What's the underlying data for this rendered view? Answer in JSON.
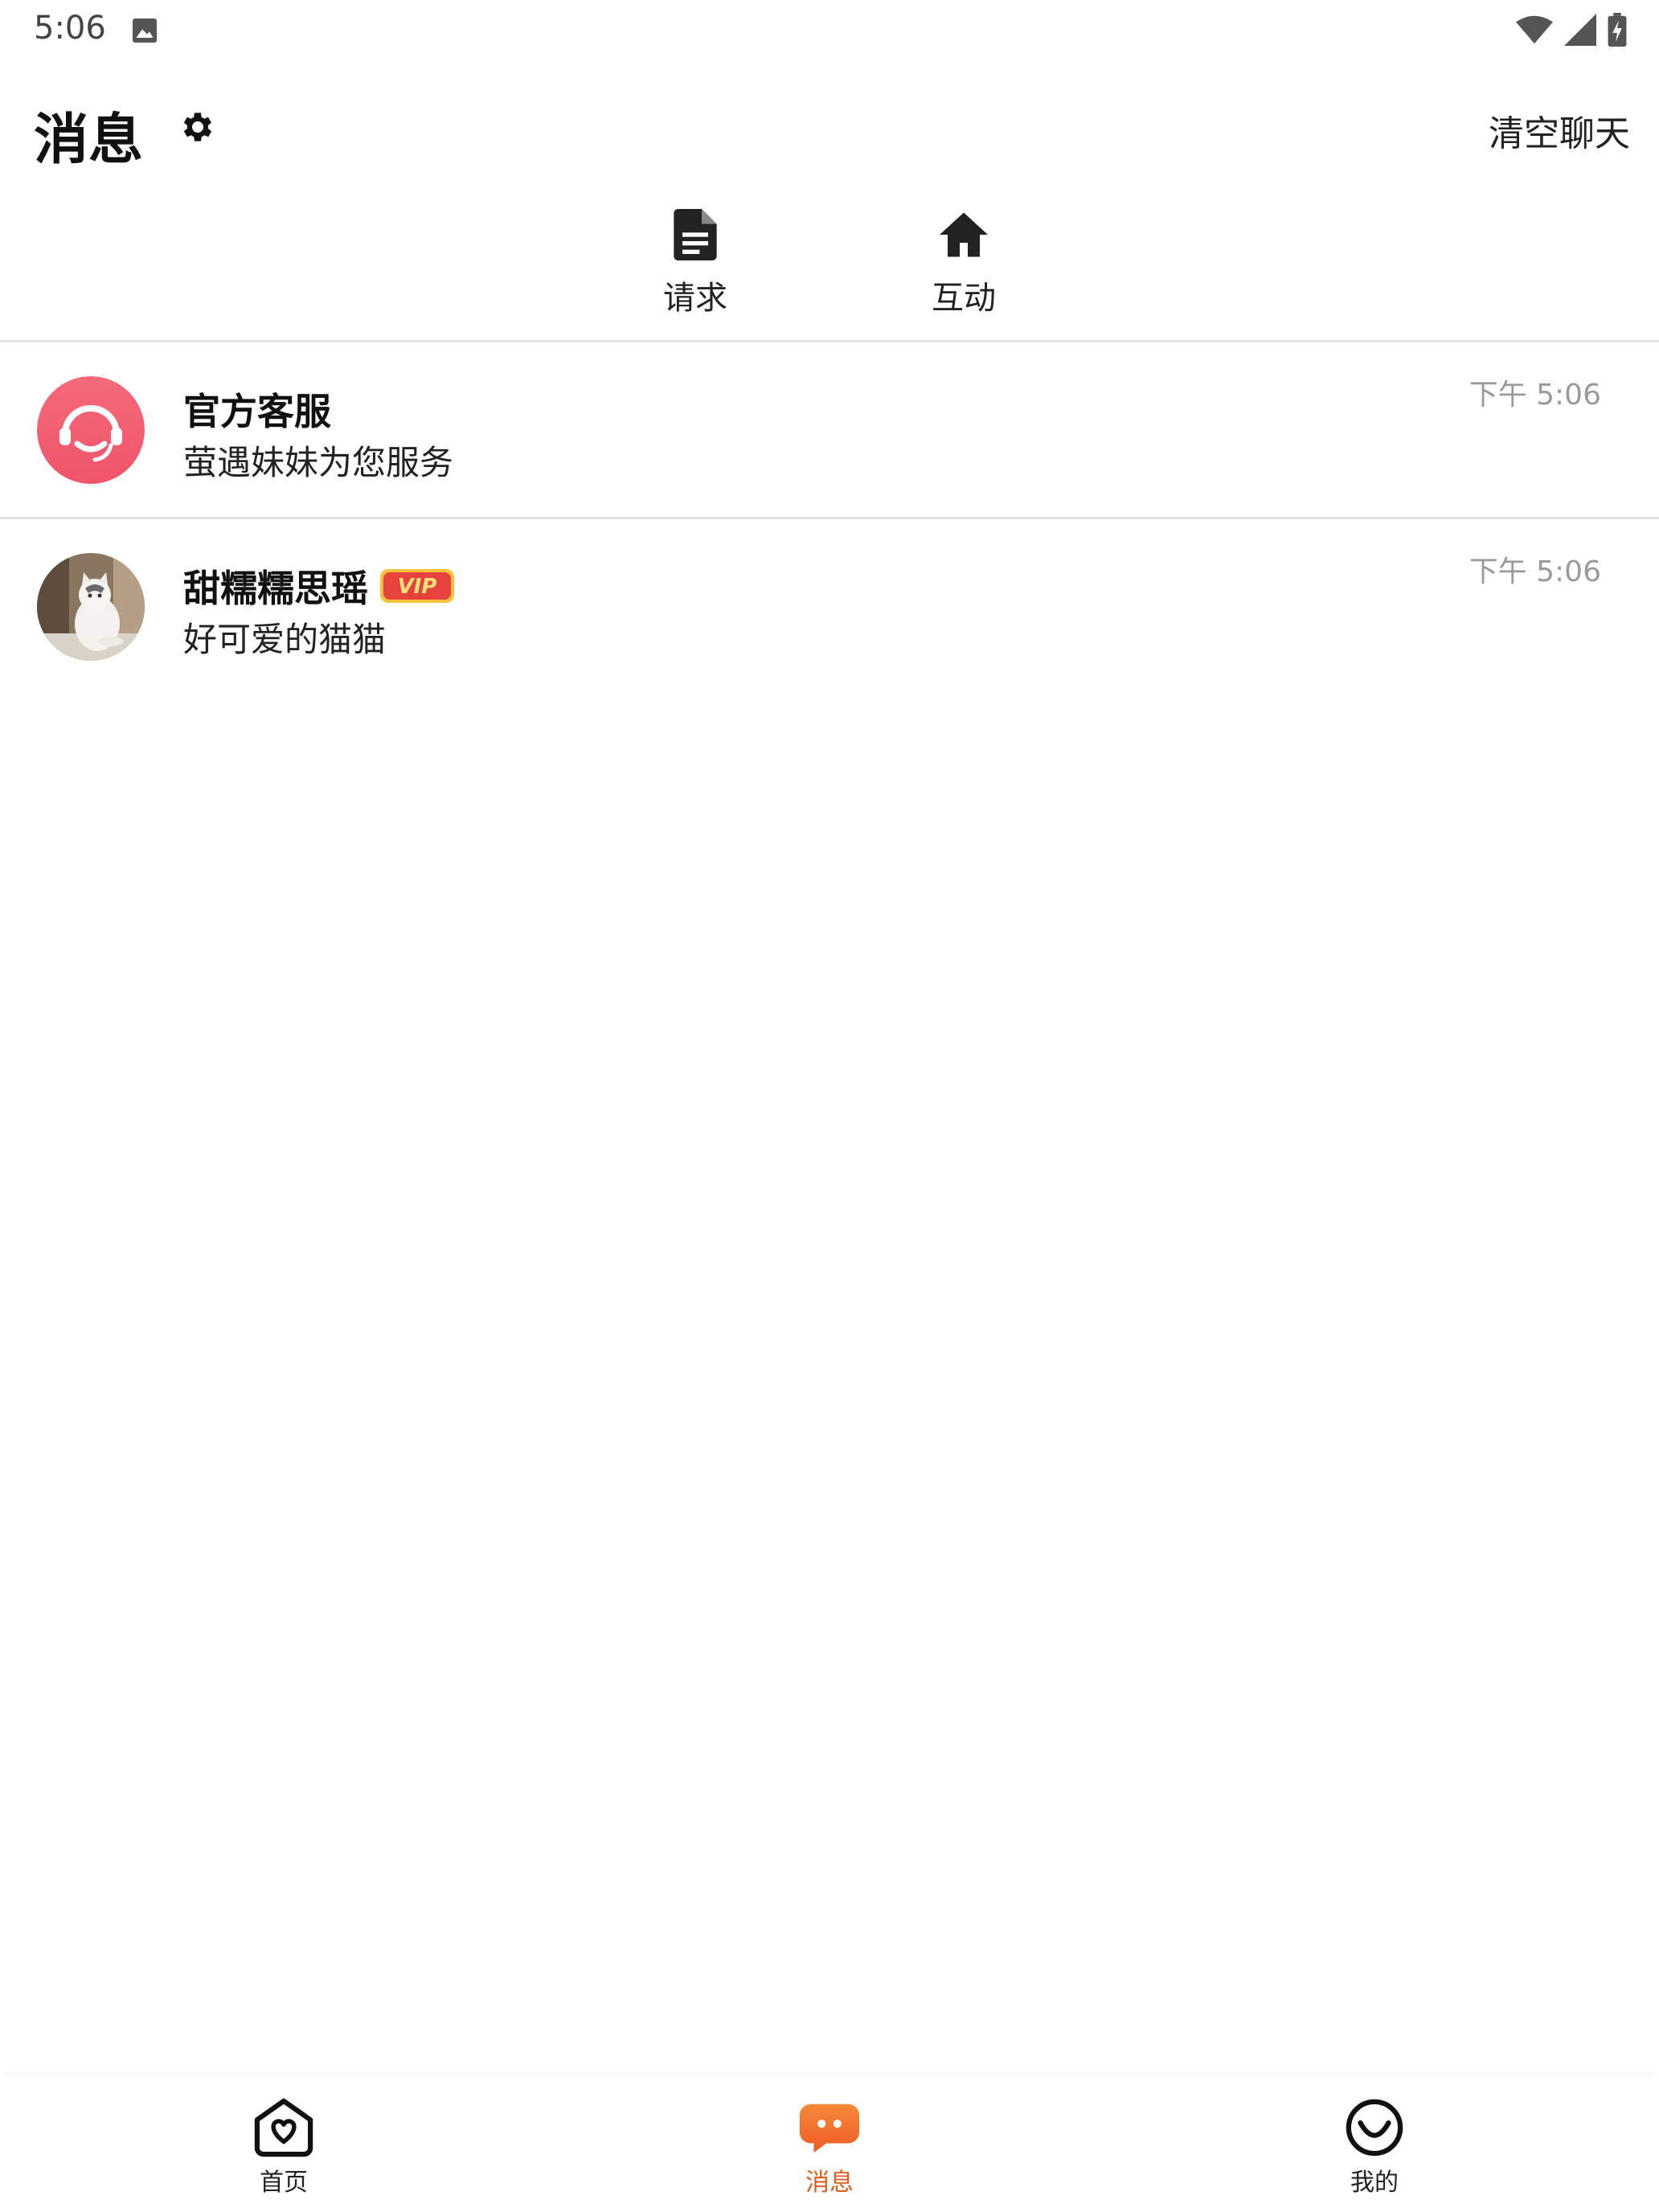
{
  "status_bar": {
    "time": "5:06",
    "icons": [
      "image-icon",
      "wifi-icon",
      "signal-icon",
      "battery-charging-icon"
    ]
  },
  "header": {
    "title": "消息",
    "settings_icon": "gear-icon",
    "clear_label": "清空聊天"
  },
  "tabs": [
    {
      "label": "请求",
      "icon": "document-icon"
    },
    {
      "label": "互动",
      "icon": "home-icon"
    }
  ],
  "conversations": [
    {
      "name": "官方客服",
      "preview": "萤遇妹妹为您服务",
      "time": "下午 5:06",
      "avatar": "customer-service-avatar",
      "vip": false
    },
    {
      "name": "甜糯糯思瑶",
      "preview": "好可爱的猫猫",
      "time": "下午 5:06",
      "avatar": "cat-photo-avatar",
      "vip": true,
      "badge": "VIP"
    }
  ],
  "bottom_nav": {
    "items": [
      {
        "label": "首页",
        "icon": "home-heart-icon",
        "active": false
      },
      {
        "label": "消息",
        "icon": "chat-bubble-icon",
        "active": true
      },
      {
        "label": "我的",
        "icon": "smile-icon",
        "active": false
      }
    ]
  },
  "colors": {
    "accent": "#f0692a",
    "service_avatar": "#f05f72",
    "vip_badge": "#e8423f",
    "timestamp": "#9a9a9a"
  }
}
